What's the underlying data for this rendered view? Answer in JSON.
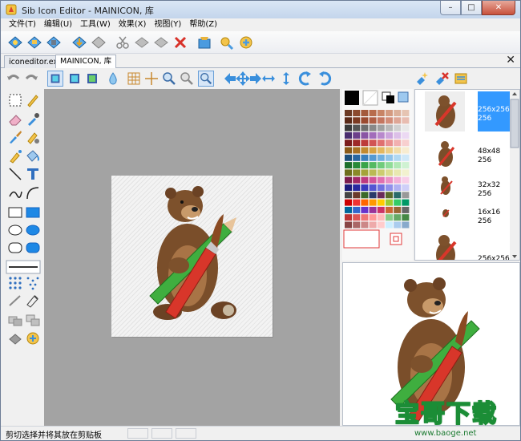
{
  "window": {
    "title": "Sib Icon Editor - MAINICON, 库",
    "controls": {
      "minimize": "–",
      "maximize": "□",
      "close": "✕"
    }
  },
  "menu": [
    "文件(T)",
    "编辑(U)",
    "工具(W)",
    "效果(X)",
    "视图(Y)",
    "帮助(Z)"
  ],
  "tabs": [
    {
      "label": "iconeditor.exe",
      "active": false
    },
    {
      "label": "MAINICON, 库",
      "active": true
    }
  ],
  "tab_close": "✕",
  "toolbar": {
    "icons": [
      "new-icon",
      "open-icon",
      "save-icon",
      "import-icon",
      "export-icon",
      "cut-icon",
      "copy-icon",
      "paste-icon",
      "delete-icon",
      "extract-icon",
      "settings-icon",
      "about-icon"
    ]
  },
  "toolbar2": {
    "icons": [
      "undo-icon",
      "redo-icon",
      "view-mode-1-icon",
      "view-mode-2-icon",
      "view-mode-3-icon",
      "drop-icon",
      "grid-icon",
      "crosshair-icon",
      "zoom-in-icon",
      "zoom-out-icon",
      "zoom-fit-icon",
      "move-left-icon",
      "move-all-icon",
      "move-right-icon",
      "flip-horizontal-icon",
      "flip-vertical-icon",
      "rotate-left-icon",
      "rotate-right-icon",
      "add-format-icon",
      "remove-format-icon",
      "format-properties-icon"
    ]
  },
  "tools": {
    "icons": [
      "select-rect-icon",
      "pencil-icon",
      "eraser-icon",
      "color-picker-icon",
      "brush-icon",
      "clone-icon",
      "airbrush-icon",
      "fill-icon",
      "line-icon",
      "text-icon",
      "curve-icon",
      "arc-icon",
      "rect-outline-icon",
      "rect-filled-icon",
      "ellipse-outline-icon",
      "ellipse-filled-icon",
      "rounded-rect-outline-icon",
      "rounded-rect-filled-icon",
      "line-width-icon",
      "pattern-dots-icon",
      "pattern-grid-icon",
      "gradient-icon",
      "blur-icon",
      "layers-icon",
      "shadow-icon",
      "emboss-icon",
      "hand-icon"
    ]
  },
  "formats": [
    {
      "size": "256x256",
      "depth": "256",
      "selected": true
    },
    {
      "size": "48x48",
      "depth": "256",
      "selected": false
    },
    {
      "size": "32x32",
      "depth": "256",
      "selected": false
    },
    {
      "size": "16x16",
      "depth": "256",
      "selected": false
    },
    {
      "size": "256x256",
      "depth": "",
      "selected": false
    }
  ],
  "status": {
    "text": "剪切选择并将其放在剪贴板"
  },
  "watermark": {
    "main": "宝哥下载",
    "url": "www.baoge.net"
  },
  "colors": {
    "canvas_bg": "#a3a3a3",
    "selection": "#3399ff",
    "watermark_green": "#1b8d36"
  }
}
